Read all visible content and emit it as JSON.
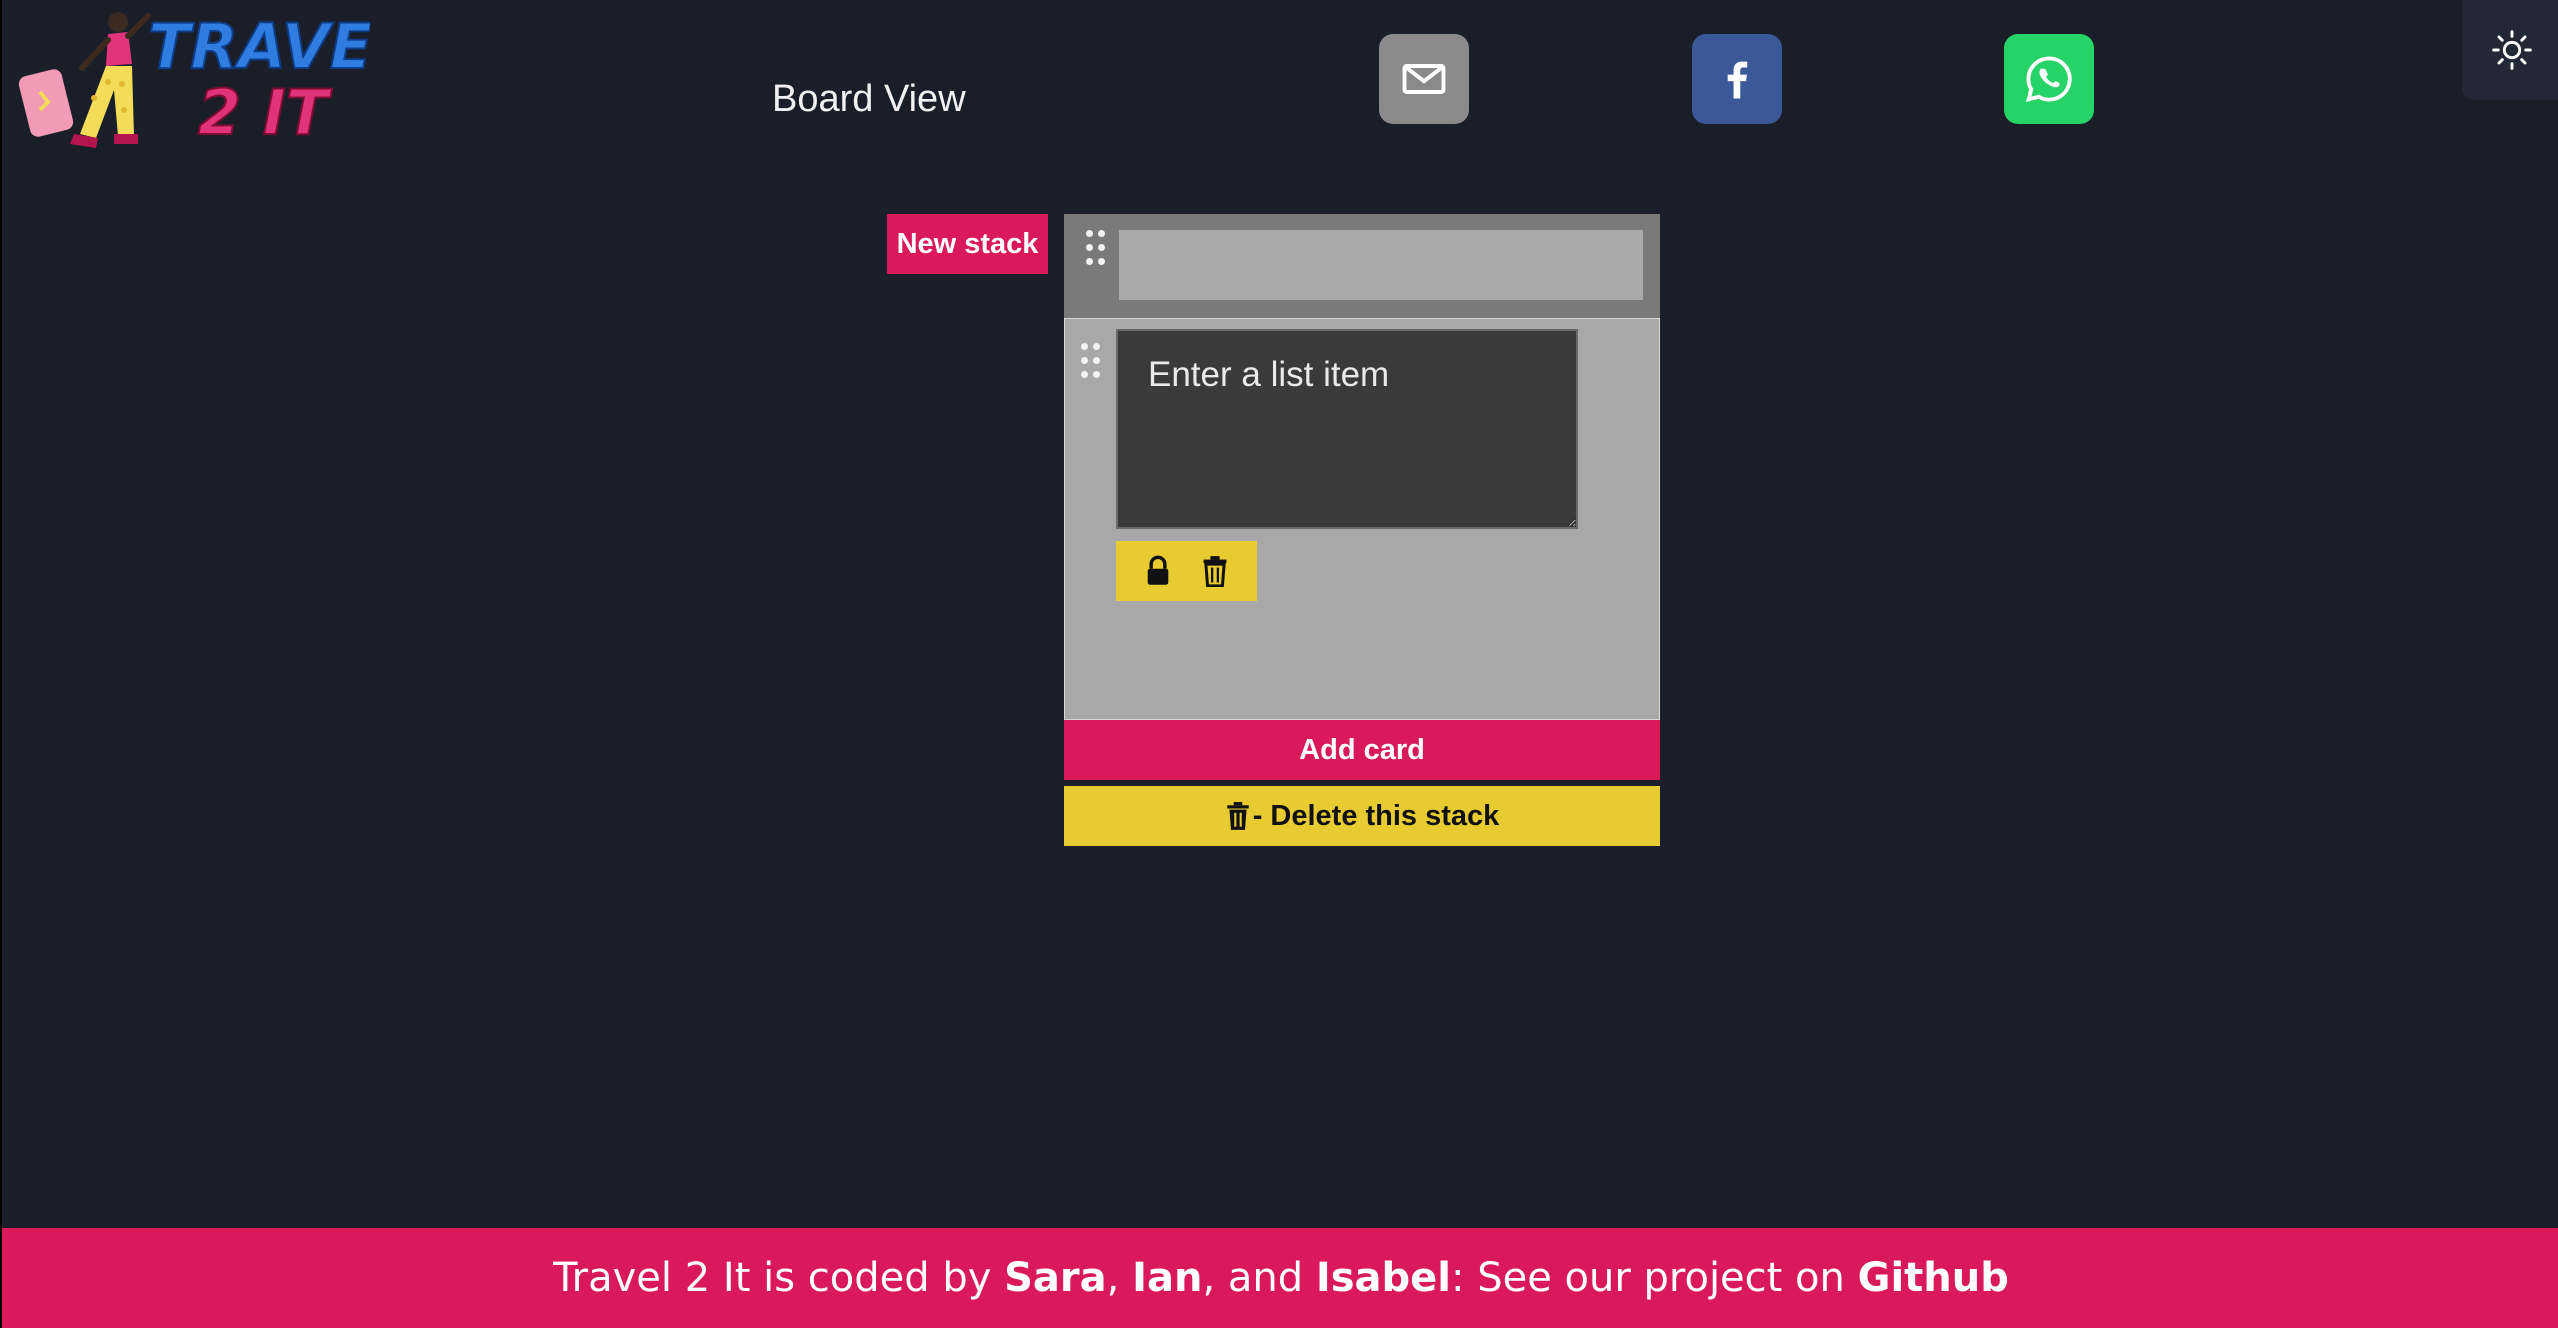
{
  "header": {
    "logo_line1": "TRAVEL",
    "logo_line2": "2 IT",
    "page_title": "Board View",
    "share": {
      "email_icon": "envelope-icon",
      "facebook_icon": "facebook-icon",
      "whatsapp_icon": "whatsapp-icon"
    },
    "theme_toggle_icon": "sun-icon"
  },
  "board": {
    "new_stack_label": "New stack",
    "stack": {
      "title_value": "",
      "card": {
        "placeholder": "Enter a list item",
        "value": "",
        "lock_icon": "lock-icon",
        "delete_icon": "trash-icon"
      },
      "add_card_label": "Add card",
      "delete_stack_label": "- Delete this stack"
    }
  },
  "footer": {
    "prefix": "Travel 2 It is coded by ",
    "name1": "Sara",
    "sep1": ", ",
    "name2": "Ian",
    "sep2": ", and ",
    "name3": "Isabel",
    "middle": ": See our project on ",
    "link": "Github"
  },
  "colors": {
    "background": "#1b1f2b",
    "accent_pink": "#d9195c",
    "accent_yellow": "#e7cb31",
    "email": "#8a8a8a",
    "facebook": "#3b5998",
    "whatsapp": "#25d366"
  }
}
